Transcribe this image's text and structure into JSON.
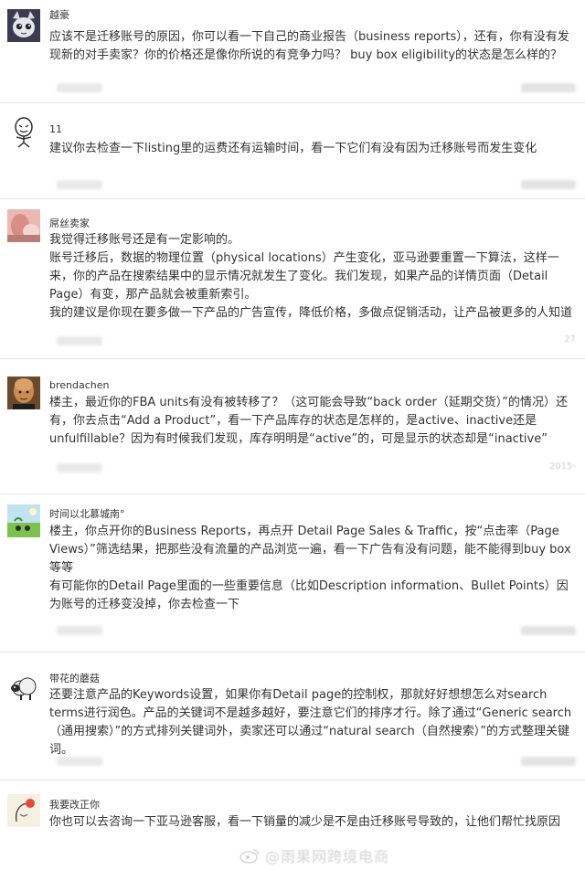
{
  "posts": [
    {
      "username": "越豪",
      "lines": [
        "应该不是迁移账号的原因，你可以看一下自己的商业报告（business reports），还有，你有没有发现新的对手卖家？你的价格还是像你所说的有竞争力吗？ buy box eligibility的状态是怎么样的？"
      ]
    },
    {
      "username": "11",
      "lines": [
        "建议你去检查一下listing里的运费还有运输时间，看一下它们有没有因为迁移账号而发生变化"
      ]
    },
    {
      "username": "屌丝卖家",
      "meta": "27",
      "lines": [
        "我觉得迁移账号还是有一定影响的。",
        "账号迁移后，数据的物理位置（physical locations）产生变化，亚马逊要重置一下算法，这样一来，你的产品在搜索结果中的显示情况就发生了变化。我们发现，如果产品的详情页面（Detail Page）有变，那产品就会被重新索引。",
        "我的建议是你现在要多做一下产品的广告宣传，降低价格，多做点促销活动，让产品被更多的人知道"
      ]
    },
    {
      "username": "brendachen",
      "meta": "2015-",
      "lines": [
        "楼主，最近你的FBA units有没有被转移了？（这可能会导致“back order（延期交货）”的情况）还有，你去点击“Add a Product”，看一下产品库存的状态是怎样的，是active、inactive还是unfulfillable？因为有时候我们发现，库存明明是“active”的，可是显示的状态却是“inactive”"
      ]
    },
    {
      "username": "时间以北慕城南°",
      "lines": [
        "楼主，你点开你的Business Reports，再点开 Detail Page Sales & Traffic，按“点击率（Page Views）”筛选结果，把那些没有流量的产品浏览一遍，看一下广告有没有问题，能不能得到buy box等等",
        "有可能你的Detail Page里面的一些重要信息（比如Description information、Bullet Points）因为账号的迁移变没掉，你去检查一下"
      ]
    },
    {
      "username": "带花的蘑菇",
      "lines": [
        "还要注意产品的Keywords设置，如果你有Detail page的控制权，那就好好想想怎么对search terms进行润色。产品的关键词不是越多越好，要注意它们的排序才行。除了通过“Generic search（通用搜索）”的方式排列关键词外，卖家还可以通过“natural search（自然搜索）”的方式整理关键词。"
      ]
    },
    {
      "username": "我要改正你",
      "lines": [
        "你也可以去咨询一下亚马逊客服，看一下销量的减少是不是由迁移账号导致的，让他们帮忙找原因"
      ]
    }
  ],
  "watermark": {
    "text": "@雨果网跨境电商",
    "icon": "weibo-icon"
  },
  "icons": {
    "avatar_1": "cartoon-cat-avatar-icon",
    "avatar_2": "stick-figure-meme-avatar-icon",
    "avatar_3": "pink-photo-avatar-icon",
    "avatar_4": "bald-man-avatar-icon",
    "avatar_5": "green-field-avatar-icon",
    "avatar_6": "sheep-avatar-icon",
    "avatar_7": "cartoon-avatar-icon"
  }
}
